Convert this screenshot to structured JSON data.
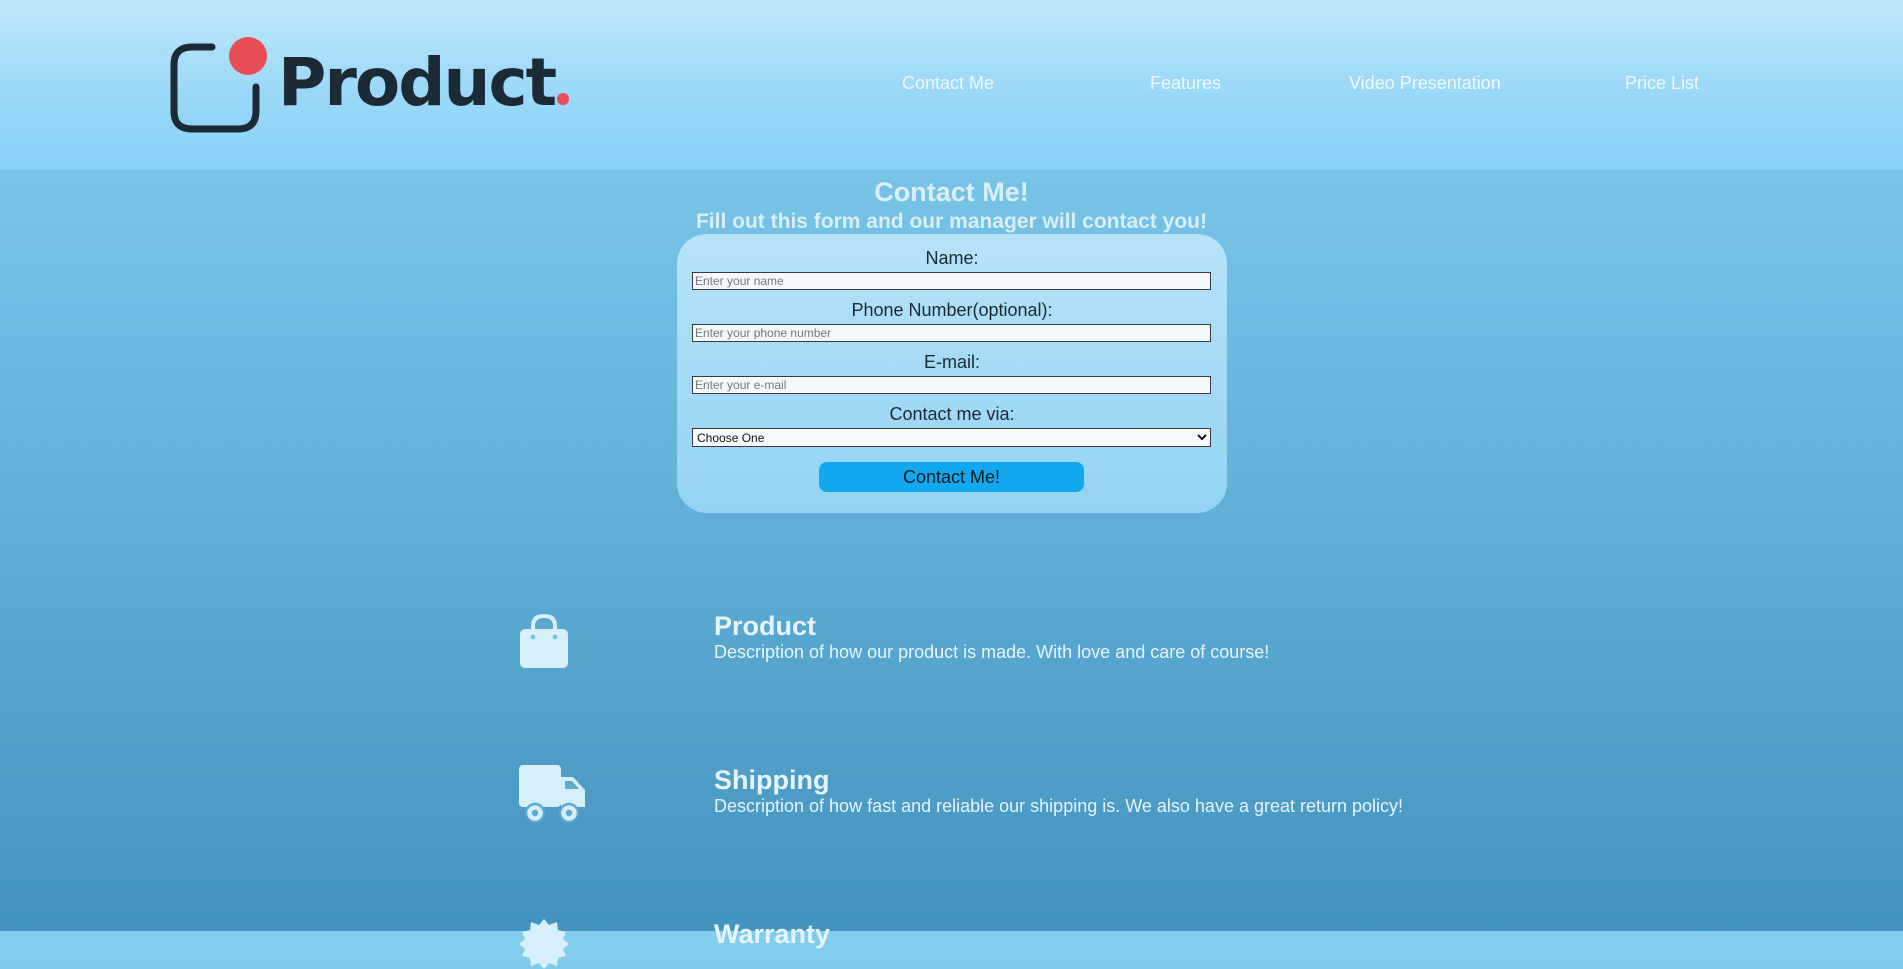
{
  "header": {
    "logo_text": "Product",
    "nav": {
      "contact": "Contact Me",
      "features": "Features",
      "video": "Video Presentation",
      "price": "Price List"
    }
  },
  "contact": {
    "title": "Contact Me!",
    "subtitle": "Fill out this form and our manager will contact you!",
    "name_label": "Name:",
    "name_placeholder": "Enter your name",
    "phone_label": "Phone Number(optional):",
    "phone_placeholder": "Enter your phone number",
    "email_label": "E-mail:",
    "email_placeholder": "Enter your e-mail",
    "via_label": "Contact me via:",
    "via_selected": "Choose One",
    "submit_label": "Contact Me!"
  },
  "features": [
    {
      "icon": "shopping-bag-icon",
      "title": "Product",
      "description": "Description of how our product is made. With love and care of course!"
    },
    {
      "icon": "delivery-truck-icon",
      "title": "Shipping",
      "description": "Description of how fast and reliable our shipping is. We also have a great return policy!"
    },
    {
      "icon": "warranty-badge-icon",
      "title": "Warranty",
      "description": ""
    }
  ],
  "colors": {
    "accent": "#12a8ef",
    "logo_dot": "#e84c55",
    "logo_text": "#1c2a35"
  }
}
